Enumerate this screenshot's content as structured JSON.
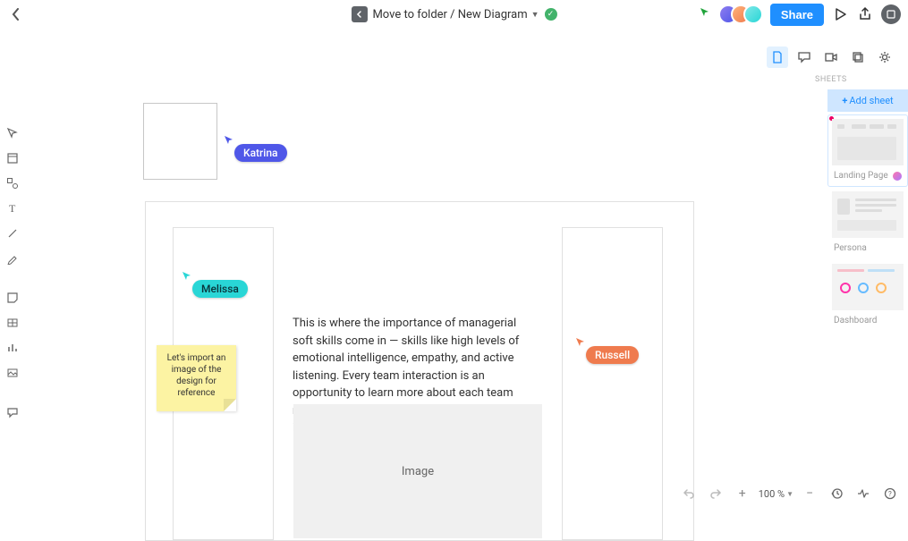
{
  "header": {
    "breadcrumb": "Move to folder / New Diagram",
    "share_label": "Share"
  },
  "collaborators": {
    "katrina": "Katrina",
    "melissa": "Melissa",
    "russell": "Russell"
  },
  "canvas": {
    "body_text": "This is where the importance of managerial soft skills come in — skills like high levels of emotional intelligence, empathy, and active listening. Every team interaction is an opportunity to learn more about each team members strengths, work preferences, interests, and current feelings about their work.",
    "image_placeholder": "Image",
    "sticky_note": "Let's import an image of the design for reference"
  },
  "sheets": {
    "section_label": "SHEETS",
    "add_label": "Add sheet",
    "items": [
      {
        "name": "Landing Page"
      },
      {
        "name": "Persona"
      },
      {
        "name": "Dashboard"
      }
    ]
  },
  "zoom": {
    "level": "100 %"
  }
}
